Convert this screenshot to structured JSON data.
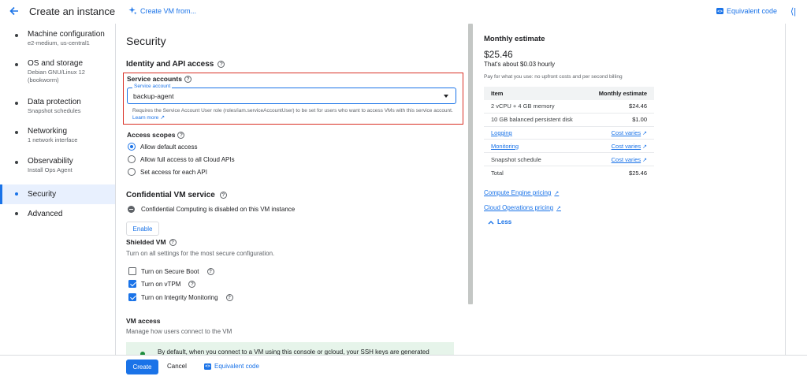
{
  "header": {
    "title": "Create an instance",
    "create_from": "Create VM from...",
    "equivalent_code": "Equivalent code"
  },
  "nav": {
    "items": [
      {
        "title": "Machine configuration",
        "sub": "e2-medium, us-central1"
      },
      {
        "title": "OS and storage",
        "sub": "Debian GNU/Linux 12 (bookworm)"
      },
      {
        "title": "Data protection",
        "sub": "Snapshot schedules"
      },
      {
        "title": "Networking",
        "sub": "1 network interface"
      },
      {
        "title": "Observability",
        "sub": "Install Ops Agent"
      },
      {
        "title": "Security",
        "sub": ""
      },
      {
        "title": "Advanced",
        "sub": ""
      }
    ],
    "active_index": 5
  },
  "security": {
    "title": "Security",
    "identity_heading": "Identity and API access",
    "service_accounts_heading": "Service accounts",
    "service_account_label": "Service account",
    "service_account_value": "backup-agent",
    "service_account_help": "Requires the Service Account User role (roles/iam.serviceAccountUser) to be set for users who want to access VMs with this service account.",
    "learn_more": "Learn more",
    "access_scopes_heading": "Access scopes",
    "scopes": [
      {
        "label": "Allow default access",
        "selected": true
      },
      {
        "label": "Allow full access to all Cloud APIs",
        "selected": false
      },
      {
        "label": "Set access for each API",
        "selected": false
      }
    ],
    "confidential_heading": "Confidential VM service",
    "confidential_status": "Confidential Computing is disabled on this VM instance",
    "enable_label": "Enable",
    "shielded_heading": "Shielded VM",
    "shielded_desc": "Turn on all settings for the most secure configuration.",
    "shielded_options": [
      {
        "label": "Turn on Secure Boot",
        "checked": false
      },
      {
        "label": "Turn on vTPM",
        "checked": true
      },
      {
        "label": "Turn on Integrity Monitoring",
        "checked": true
      }
    ],
    "vm_access_heading": "VM access",
    "vm_access_desc": "Manage how users connect to the VM",
    "vm_access_note": "By default, when you connect to a VM using this console or gcloud, your SSH keys are generated"
  },
  "estimate": {
    "title": "Monthly estimate",
    "price": "$25.46",
    "hourly": "That's about $0.03 hourly",
    "note": "Pay for what you use: no upfront costs and per second billing",
    "col_item": "Item",
    "col_estimate": "Monthly estimate",
    "rows": [
      {
        "item": "2 vCPU + 4 GB memory",
        "amount": "$24.46"
      },
      {
        "item": "10 GB balanced persistent disk",
        "amount": "$1.00"
      },
      {
        "item": "Logging",
        "amount": "Cost varies"
      },
      {
        "item": "Monitoring",
        "amount": "Cost varies"
      },
      {
        "item": "Snapshot schedule",
        "amount": "Cost varies"
      },
      {
        "item": "Total",
        "amount": "$25.46"
      }
    ],
    "link_compute": "Compute Engine pricing",
    "link_ops": "Cloud Operations pricing",
    "less_label": "Less"
  },
  "footer": {
    "create": "Create",
    "cancel": "Cancel",
    "equivalent_code": "Equivalent code"
  },
  "colors": {
    "accent": "#1a73e8",
    "highlight_border": "#d93025",
    "active_nav_bg": "#e8f0fe"
  }
}
